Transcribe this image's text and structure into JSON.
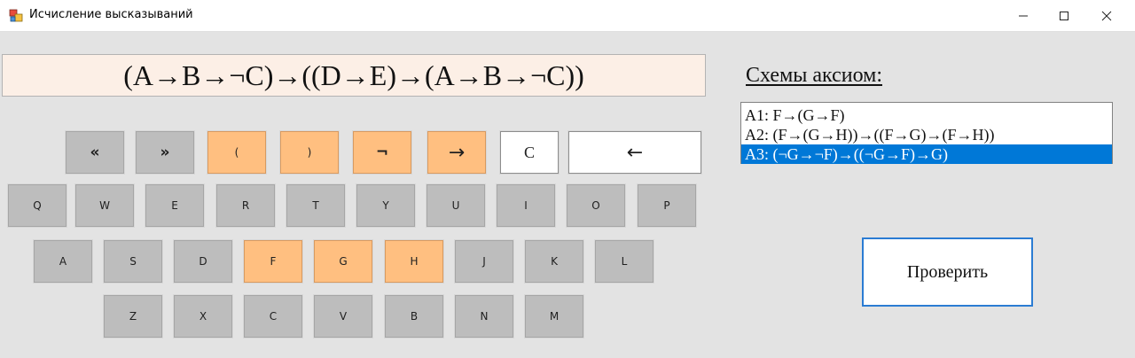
{
  "window": {
    "title": "Исчисление высказываний",
    "controls": {
      "minimize": "—",
      "maximize": "☐",
      "close": "✕"
    }
  },
  "expression": "(A→B→¬C)→((D→E)→(A→B→¬C))",
  "keyboard": {
    "top_row": [
      "«",
      "»",
      "(",
      ")",
      "¬",
      "→",
      "C",
      "←"
    ],
    "row1": [
      "Q",
      "W",
      "E",
      "R",
      "T",
      "Y",
      "U",
      "I",
      "O",
      "P"
    ],
    "row2": [
      "A",
      "S",
      "D",
      "F",
      "G",
      "H",
      "J",
      "K",
      "L"
    ],
    "row3": [
      "Z",
      "X",
      "C",
      "V",
      "B",
      "N",
      "M"
    ]
  },
  "axioms": {
    "title": "Схемы аксиом:",
    "items": [
      "A1:  F→(G→F)",
      "A2:  (F→(G→H))→((F→G)→(F→H))",
      "A3:  (¬G→¬F)→((¬G→F)→G)"
    ],
    "selected_index": 2
  },
  "check_button": "Проверить",
  "colors": {
    "accent_orange": "#ffbf80",
    "key_gray": "#bdbdbd",
    "selection_blue": "#0078d7",
    "expression_bg": "#fcefe6"
  }
}
